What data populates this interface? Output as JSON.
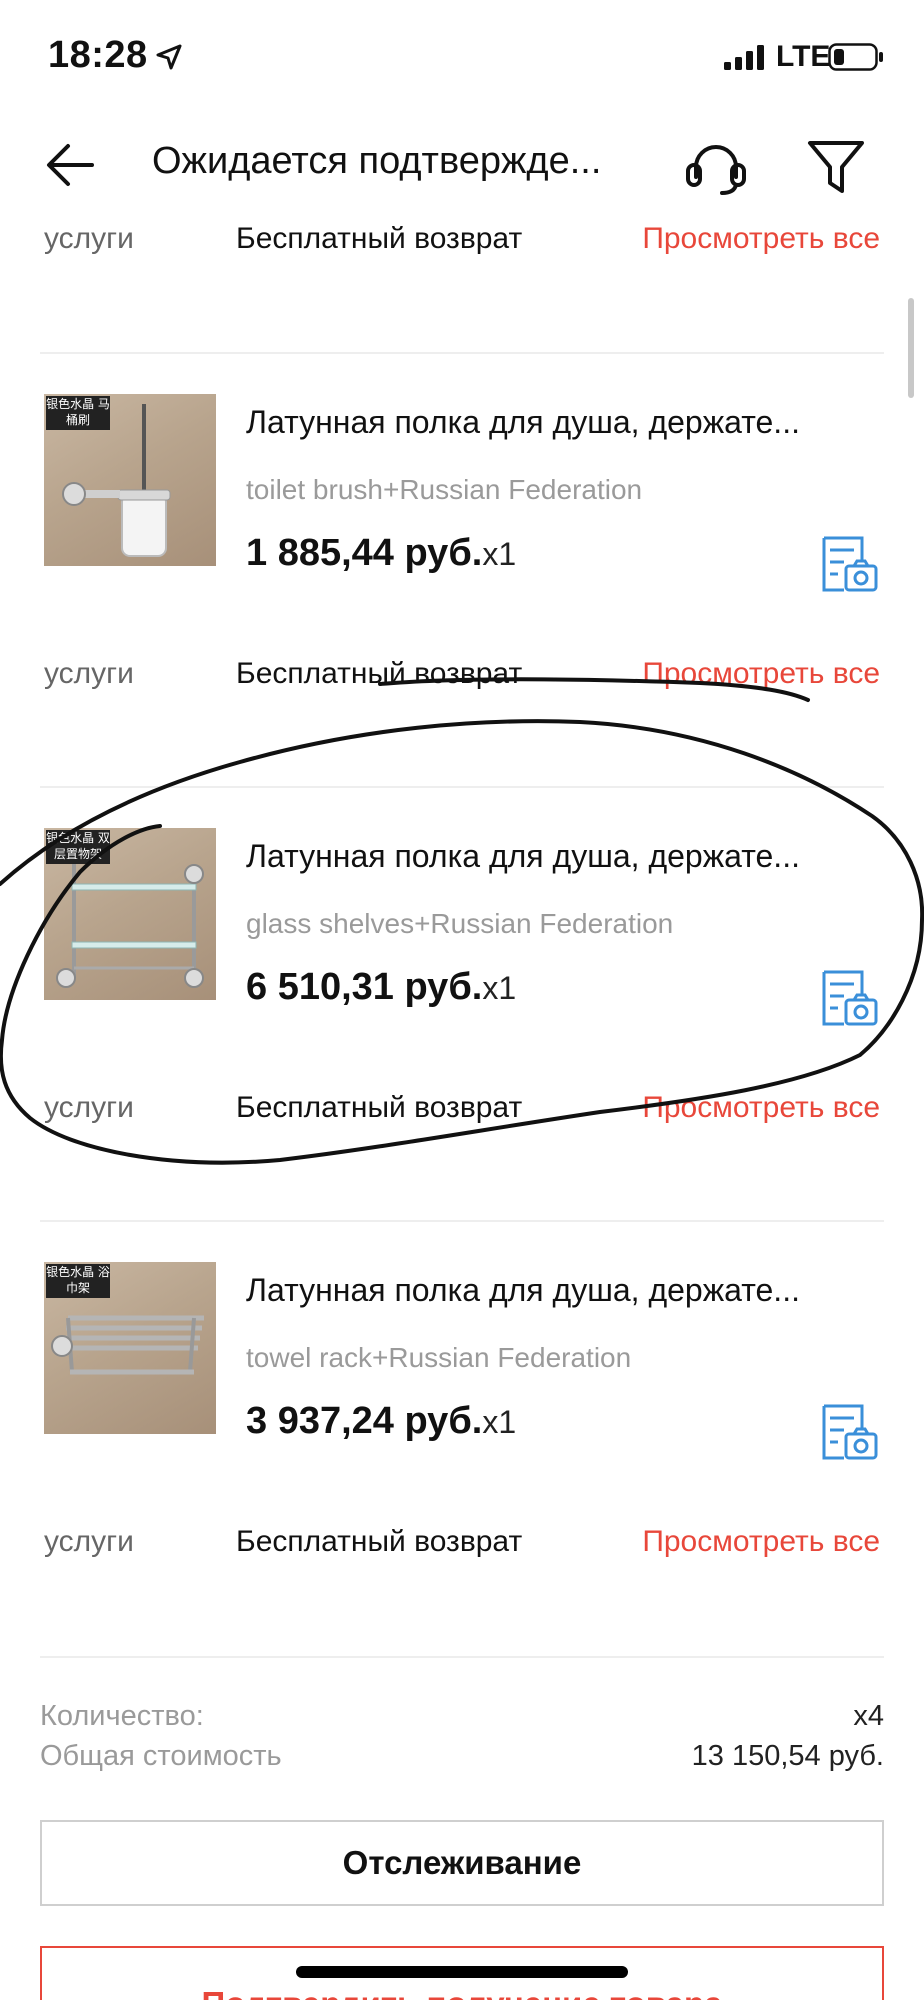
{
  "status_bar": {
    "time": "18:28",
    "network": "LTE",
    "icons": [
      "location-arrow-icon",
      "signal-icon",
      "battery-icon"
    ]
  },
  "header": {
    "title": "Ожидается подтвержде...",
    "icons": [
      "back-arrow-icon",
      "support-headset-icon",
      "filter-icon"
    ]
  },
  "services_rows": [
    {
      "label": "услуги",
      "value": "Бесплатный возврат",
      "link": "Просмотреть все"
    },
    {
      "label": "услуги",
      "value": "Бесплатный возврат",
      "link": "Просмотреть все"
    },
    {
      "label": "услуги",
      "value": "Бесплатный возврат",
      "link": "Просмотреть все"
    },
    {
      "label": "услуги",
      "value": "Бесплатный возврат",
      "link": "Просмотреть все"
    }
  ],
  "products": [
    {
      "image_tag": "银色水晶 马桶刷",
      "title": "Латунная полка для душа, держате...",
      "variant": "toilet brush+Russian Federation",
      "price": "1 885,44 руб.",
      "qty": "x1"
    },
    {
      "image_tag": "银色水晶 双层置物架",
      "title": "Латунная полка для душа, держате...",
      "variant": "glass shelves+Russian Federation",
      "price": "6 510,31 руб.",
      "qty": "x1"
    },
    {
      "image_tag": "银色水晶 浴巾架",
      "title": "Латунная полка для душа, держате...",
      "variant": "towel rack+Russian Federation",
      "price": "3 937,24 руб.",
      "qty": "x1"
    }
  ],
  "summary": {
    "quantity_label": "Количество:",
    "quantity_value": "x4",
    "total_label": "Общая стоимость",
    "total_value": "13 150,54 руб."
  },
  "buttons": {
    "track": "Отслеживание",
    "confirm": "Подтвердить получение товара"
  },
  "colors": {
    "accent": "#e8473a",
    "icon_blue": "#3a8fd9",
    "muted_text": "#9a9a9a"
  }
}
